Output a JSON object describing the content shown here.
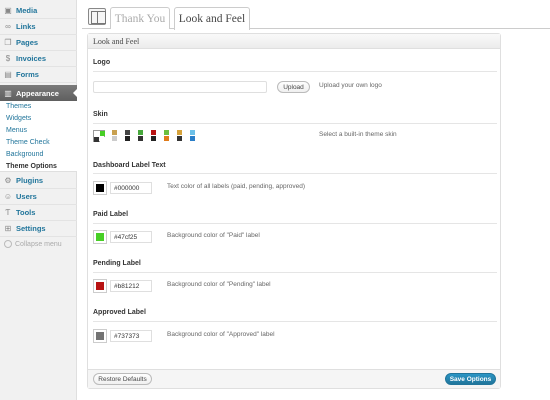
{
  "sidebar": {
    "items_top": [
      {
        "label": "Media",
        "icon": "media-icon"
      },
      {
        "label": "Links",
        "icon": "links-icon"
      },
      {
        "label": "Pages",
        "icon": "pages-icon"
      },
      {
        "label": "Invoices",
        "icon": "invoices-icon"
      },
      {
        "label": "Forms",
        "icon": "forms-icon"
      }
    ],
    "active": {
      "label": "Appearance",
      "icon": "appearance-icon"
    },
    "submenu": [
      "Themes",
      "Widgets",
      "Menus",
      "Theme Check",
      "Background",
      "Theme Options"
    ],
    "items_bottom": [
      {
        "label": "Plugins",
        "icon": "plugins-icon"
      },
      {
        "label": "Users",
        "icon": "users-icon"
      },
      {
        "label": "Tools",
        "icon": "tools-icon"
      },
      {
        "label": "Settings",
        "icon": "settings-icon"
      }
    ],
    "collapse_label": "Collapse menu"
  },
  "tabs": {
    "inactive": "Thank You",
    "active": "Look and Feel"
  },
  "panel": {
    "title": "Look and Feel",
    "logo": {
      "title": "Logo",
      "value": "",
      "upload_button": "Upload",
      "description": "Upload your own logo"
    },
    "skin": {
      "title": "Skin",
      "description": "Select a built-in theme skin"
    },
    "dashboard_label": {
      "title": "Dashboard Label Text",
      "value": "#000000",
      "color": "#000000",
      "description": "Text color of all labels (paid, pending, approved)"
    },
    "paid_label": {
      "title": "Paid Label",
      "value": "#47cf25",
      "color": "#47cf25",
      "description": "Background color of \"Paid\" label"
    },
    "pending_label": {
      "title": "Pending Label",
      "value": "#b81212",
      "color": "#b81212",
      "description": "Background color of \"Pending\" label"
    },
    "approved_label": {
      "title": "Approved Label",
      "value": "#737373",
      "color": "#737373",
      "description": "Background color of \"Approved\" label"
    },
    "restore_button": "Restore Defaults",
    "save_button": "Save Options"
  },
  "colors": {
    "link": "#21759b",
    "skins": [
      [
        "#ffffff",
        "#47cf25",
        "#333333",
        "#ffffff"
      ],
      [
        "#ffffff",
        "#c8a050",
        "#ffffff",
        "#cccccc"
      ],
      [
        "#ffffff",
        "#444444",
        "#ffffff",
        "#222222"
      ],
      [
        "#ffffff",
        "#47a83c",
        "#ffffff",
        "#333333"
      ],
      [
        "#ffffff",
        "#b81212",
        "#ffffff",
        "#222222"
      ],
      [
        "#ffffff",
        "#6cbf3e",
        "#ffffff",
        "#e07b1a"
      ],
      [
        "#ffffff",
        "#d6a23a",
        "#ffffff",
        "#333333"
      ],
      [
        "#ffffff",
        "#6cc0e8",
        "#ffffff",
        "#2a7ec8"
      ]
    ]
  }
}
